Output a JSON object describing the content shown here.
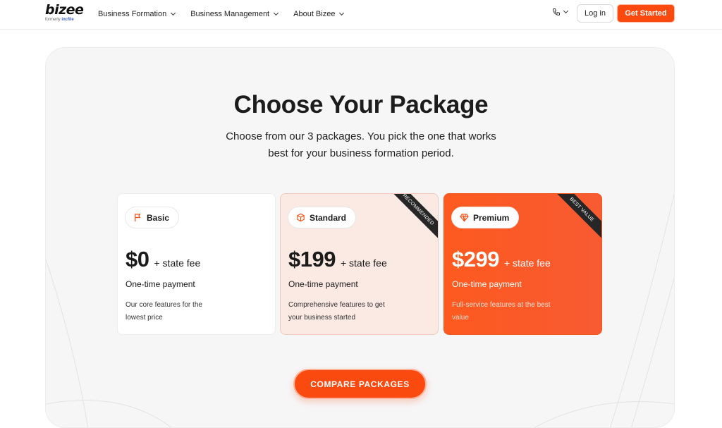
{
  "header": {
    "logo_text": "bizee",
    "logo_sub_prefix": "formerly ",
    "logo_sub_brand": "incfile",
    "nav": [
      {
        "label": "Business Formation"
      },
      {
        "label": "Business Management"
      },
      {
        "label": "About Bizee"
      }
    ],
    "phone_icon": "phone-icon",
    "login_label": "Log in",
    "cta_label": "Get Started"
  },
  "hero": {
    "title": "Choose Your Package",
    "subtitle_line1": "Choose from our 3 packages. You pick the one that works",
    "subtitle_line2": "best for your business formation period."
  },
  "packages": [
    {
      "name": "Basic",
      "icon": "flag-icon",
      "price": "$0",
      "fee": "+ state fee",
      "frequency": "One-time payment",
      "description": "Our core features for the lowest price",
      "ribbon": ""
    },
    {
      "name": "Standard",
      "icon": "box-icon",
      "price": "$199",
      "fee": "+ state fee",
      "frequency": "One-time payment",
      "description": "Comprehensive features to get your business started",
      "ribbon": "RECOMMENDED"
    },
    {
      "name": "Premium",
      "icon": "diamond-icon",
      "price": "$299",
      "fee": "+ state fee",
      "frequency": "One-time payment",
      "description": "Full-service features at the best value",
      "ribbon": "BEST VALUE"
    }
  ],
  "compare_label": "COMPARE PACKAGES",
  "colors": {
    "accent": "#fb4a0f",
    "panel_bg": "#f6f6f7",
    "standard_bg": "#fbe9e3",
    "ribbon_bg": "#262626"
  }
}
